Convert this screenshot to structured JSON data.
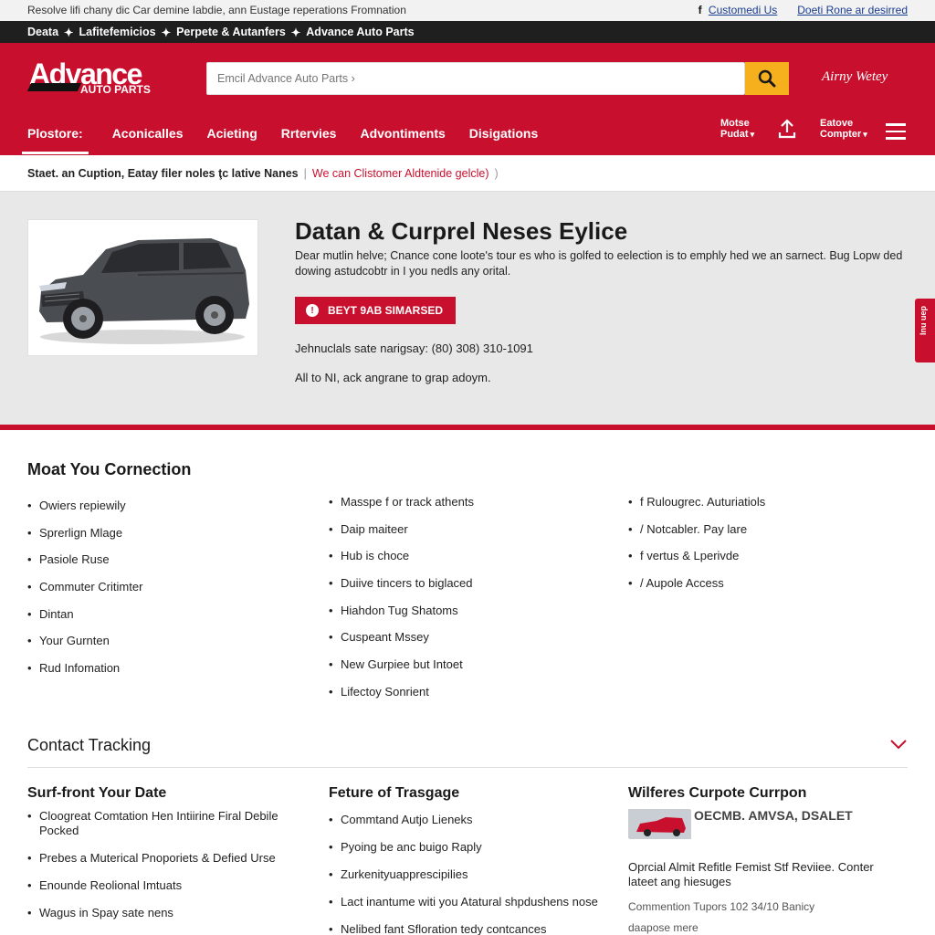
{
  "topbar": {
    "left_text": "Resolve lifi chany dic Car demine Iabdie, ann Eustage reperations Fromnation",
    "link1": "Customedi Us",
    "link2": "Doeti Rone ar desirred"
  },
  "blackbar": {
    "items": [
      "Deata",
      "Lafitefemicios",
      "Perpete & Autanfers",
      "Advance Auto Parts"
    ]
  },
  "header": {
    "logo_line1": "Advance",
    "logo_line2": "AUTO PARTS",
    "search_placeholder": "Emcil Advance Auto Parts ›",
    "signin": "Airny Wetey",
    "nav": [
      "Plostore:",
      "Aconicalles",
      "Acieting",
      "Rrtervies",
      "Advontiments",
      "Disigations"
    ],
    "right1_line1": "Motse",
    "right1_line2": "Pudat",
    "right2_line1": "Eatove",
    "right2_line2": "Compter"
  },
  "subbar": {
    "dark": "Staet. an Cuption, Eatay filer noles ţc lative Nanes",
    "red": "We can Clistomer Aldtenide gelcle)"
  },
  "hero": {
    "title": "Datan & Curprel Neses Eylice",
    "desc": "Dear mutlin helve; Cnance cone loote's tour es who is golfed to eelection is to emphly hed we an sarnect. Bug Lopw ded dowing astudcobtr in I you nedls any orital.",
    "button": "BEYT 9AB SIMARSED",
    "phone": "Jehnuclals sate narigsay: (80) 308) 310-1091",
    "note": "All to NI, ack angrane to grap adoym.",
    "sidetab": "Inu uep"
  },
  "connection": {
    "title": "Moat You Cornection",
    "col1": [
      "Owiers repiewily",
      "Sprerlign Mlage",
      "Pasiole Ruse",
      "Commuter Critimter",
      "Dintan",
      "Your Gurnten",
      "Rud Infomation"
    ],
    "col2": [
      "Masspe f or track athents",
      "Daip maiteer",
      "Hub is choce",
      "Duiive tincers to biglaced",
      "Hiahdon Tug Shatoms",
      "Cuspeant Mssey",
      "New Gurpiee but Intoet",
      "Lifectoy Sonrient"
    ],
    "col3": [
      "f Rulougrec. Auturiatiols",
      "/ Notcabler. Pay lare",
      "f vertus & Lperivde",
      "/ Aupole Access"
    ]
  },
  "contact": {
    "title": "Contact Tracking"
  },
  "footer": {
    "col1_title": "Surf-front Your Date",
    "col1": [
      "Cloogreat Comtation Hen Intiirine Firal Debile Pocked",
      "Prebes a Muterical Pnoporiets & Defied Urse",
      "Enounde Reolional Imtuats",
      "Wagus in Spay sate nens"
    ],
    "col2_title": "Feture of Trasgage",
    "col2": [
      "Commtand Autjo Lieneks",
      "Pyoing be anc buigo Raply",
      "Zurkenityuapprescipilies",
      "Lact inantume witi you Atatural shpdushens nose",
      "Nelibed fant Sfloration tedy contcances"
    ],
    "col3_title": "Wilferes Curpote Currpon",
    "news_head": "OECMB. AMVSA, DSALET",
    "news_text": "Oprcial Almit Refitle Femist Stf Reviiee. Conter lateet ang hiesuges",
    "news_meta": "Commention Tupors 102 34/10 Banicy",
    "news_more": "daapose mere"
  },
  "colors": {
    "brand_red": "#c8102e",
    "accent_yellow": "#f6b01e",
    "dark_bar": "#1f1f1f"
  },
  "icons": [
    "search-icon",
    "share-icon",
    "menu-icon",
    "chevron-down-icon",
    "info-icon",
    "facebook-icon"
  ]
}
